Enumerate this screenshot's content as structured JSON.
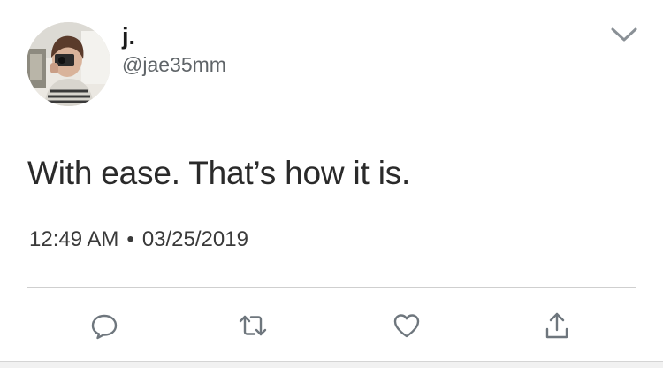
{
  "tweet": {
    "display_name": "j.",
    "handle": "@jae35mm",
    "text": "With ease. That’s how it is.",
    "time": "12:49 AM",
    "separator": "•",
    "date": "03/25/2019"
  },
  "icons": {
    "menu": "chevron-down-icon",
    "reply": "reply-icon",
    "retweet": "retweet-icon",
    "like": "heart-icon",
    "share": "share-icon"
  },
  "colors": {
    "text": "#222222",
    "secondary": "#5f6468",
    "icon": "#6e767d",
    "divider": "#cfcfcf"
  }
}
